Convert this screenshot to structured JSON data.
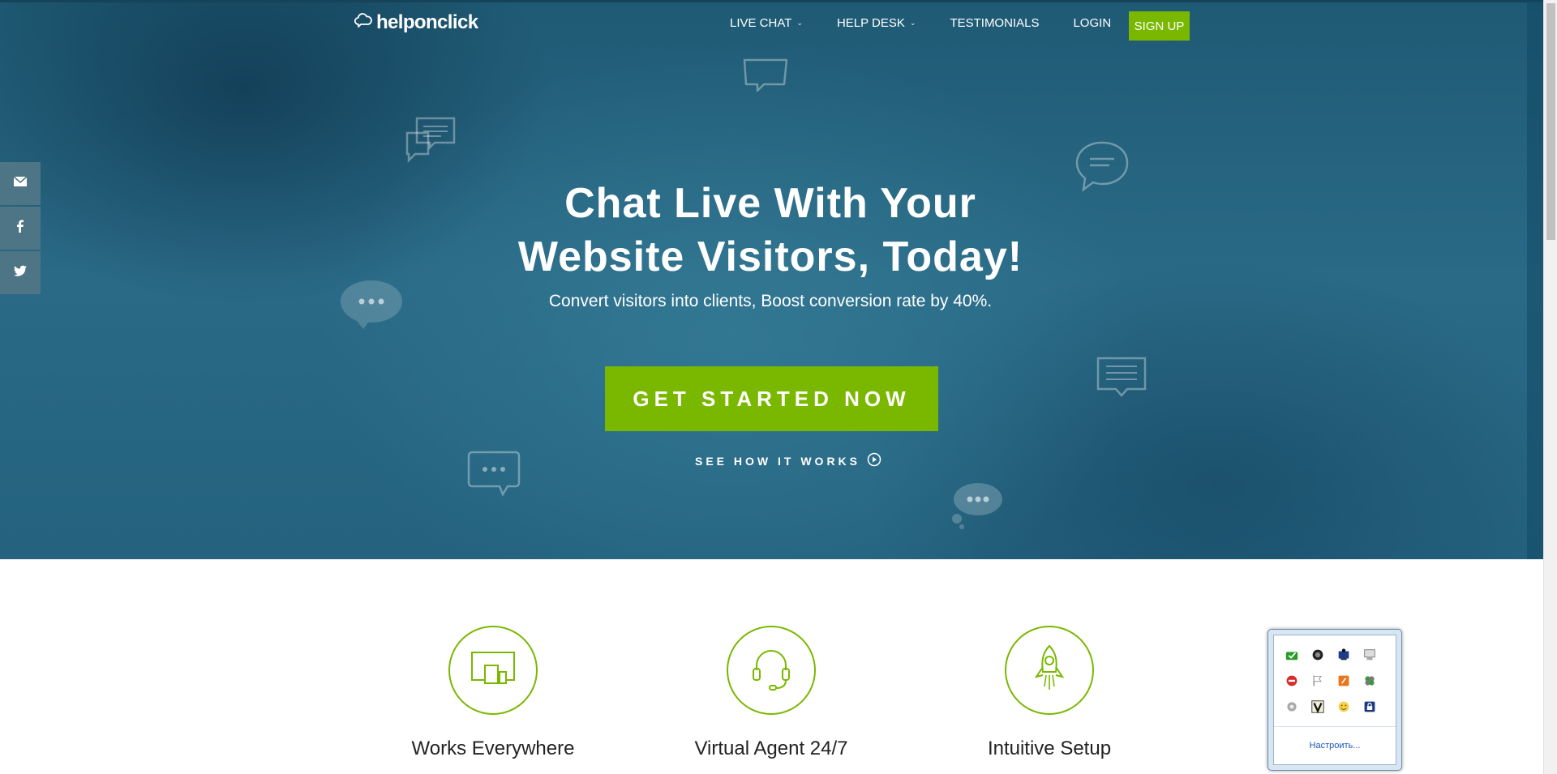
{
  "header": {
    "logo_text": "helponclick",
    "nav": [
      {
        "label": "LIVE CHAT",
        "has_caret": true
      },
      {
        "label": "HELP DESK",
        "has_caret": true
      },
      {
        "label": "TESTIMONIALS",
        "has_caret": false
      },
      {
        "label": "LOGIN",
        "has_caret": false
      }
    ],
    "signup_label": "SIGN UP",
    "caret": "⌄"
  },
  "social": [
    {
      "name": "email-share",
      "icon": "envelope-icon"
    },
    {
      "name": "facebook-share",
      "icon": "facebook-icon"
    },
    {
      "name": "twitter-share",
      "icon": "twitter-icon"
    }
  ],
  "hero": {
    "title_line1": "Chat Live With Your",
    "title_line2": "Website Visitors, Today!",
    "subtitle": "Convert visitors into clients, Boost conversion rate by 40%.",
    "cta_label": "GET STARTED NOW",
    "see_how_label": "SEE HOW IT WORKS"
  },
  "features": [
    {
      "label": "Works Everywhere",
      "icon": "devices-icon"
    },
    {
      "label": "Virtual Agent 24/7",
      "icon": "headset-icon"
    },
    {
      "label": "Intuitive Setup",
      "icon": "rocket-icon"
    }
  ],
  "tray": {
    "customize_label": "Настроить...",
    "icons": [
      "green-sync-icon",
      "dark-globe-icon",
      "blue-monitor-icon",
      "network-icon",
      "red-os-icon",
      "flag-icon",
      "orange-app-icon",
      "green-clover-icon",
      "gray-gear-icon",
      "v-app-icon",
      "smiley-icon",
      "lock-icon"
    ]
  },
  "colors": {
    "accent": "#7ab800",
    "hero_bg": "#24627e",
    "social_bg": "#4e7585"
  }
}
